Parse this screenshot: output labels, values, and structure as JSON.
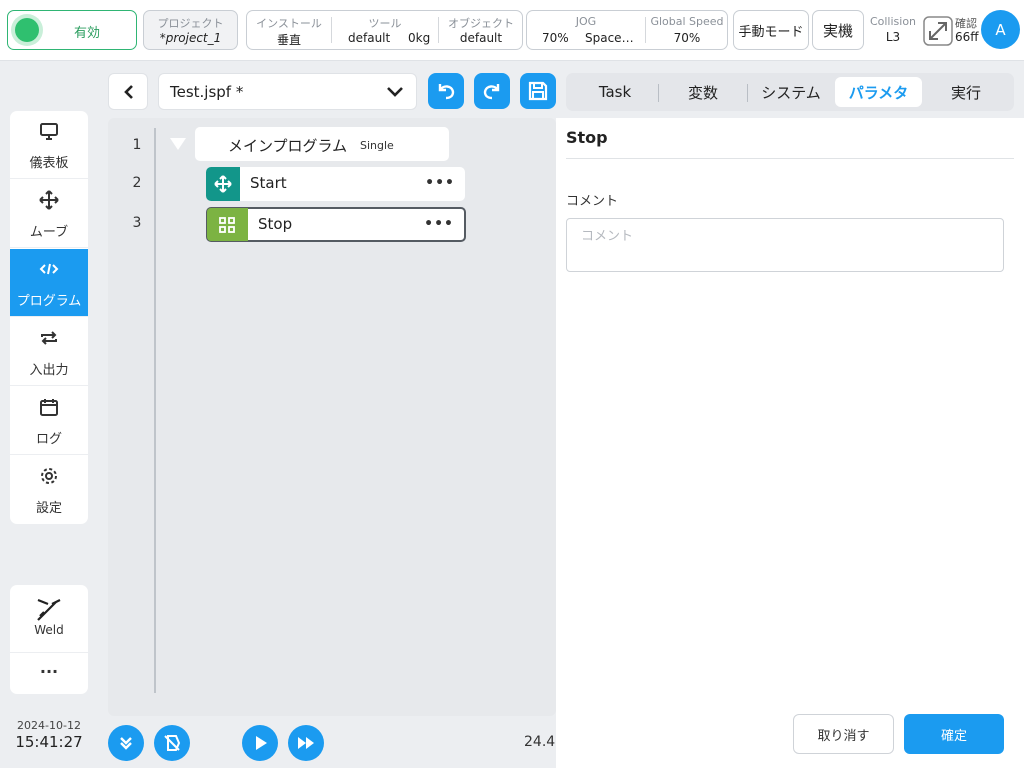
{
  "header": {
    "status": {
      "label": "有効",
      "color": "#2fc06f"
    },
    "project": {
      "label": "プロジェクト",
      "value": "*project_1"
    },
    "install": {
      "label": "インストール",
      "value": "垂直"
    },
    "tool": {
      "label": "ツール",
      "name": "default",
      "weight": "0kg"
    },
    "object": {
      "label": "オブジェクト",
      "value": "default"
    },
    "jog": {
      "label": "JOG",
      "speed": "70%",
      "mode": "Space…"
    },
    "global_speed": {
      "label": "Global Speed",
      "value": "70%"
    },
    "manual_mode": "手動モード",
    "real_machine": "実機",
    "collision": {
      "label": "Collision",
      "value": "L3"
    },
    "confirm": {
      "label": "確認",
      "value": "66ff"
    },
    "avatar": "A"
  },
  "nav": {
    "items": [
      {
        "label": "儀表板",
        "icon": "monitor-icon"
      },
      {
        "label": "ムーブ",
        "icon": "move-icon"
      },
      {
        "label": "プログラム",
        "icon": "code-icon",
        "active": true
      },
      {
        "label": "入出力",
        "icon": "io-icon"
      },
      {
        "label": "ログ",
        "icon": "calendar-icon"
      },
      {
        "label": "設定",
        "icon": "gear-icon"
      }
    ],
    "plugin": {
      "label": "Weld",
      "icon": "weld-torch-icon"
    },
    "more": "···"
  },
  "datetime": {
    "date": "2024-10-12",
    "time": "15:41:27"
  },
  "editor": {
    "file": "Test.jspf *",
    "lines": [
      {
        "no": "1",
        "label": "メインプログラム",
        "tag": "Single"
      },
      {
        "no": "2",
        "label": "Start",
        "icon": "move-icon",
        "color": "#12968a"
      },
      {
        "no": "3",
        "label": "Stop",
        "icon": "grid-icon",
        "color": "#7cb342",
        "selected": true
      }
    ],
    "zoom": "24.4"
  },
  "tabs": [
    {
      "label": "Task"
    },
    {
      "label": "変数"
    },
    {
      "label": "システム"
    },
    {
      "label": "パラメタ",
      "active": true
    },
    {
      "label": "実行"
    }
  ],
  "panel": {
    "title": "Stop",
    "comment_label": "コメント",
    "comment_placeholder": "コメント",
    "cancel": "取り消す",
    "confirm": "確定"
  },
  "colors": {
    "accent": "#1b9bf0",
    "success": "#2fc06f"
  }
}
